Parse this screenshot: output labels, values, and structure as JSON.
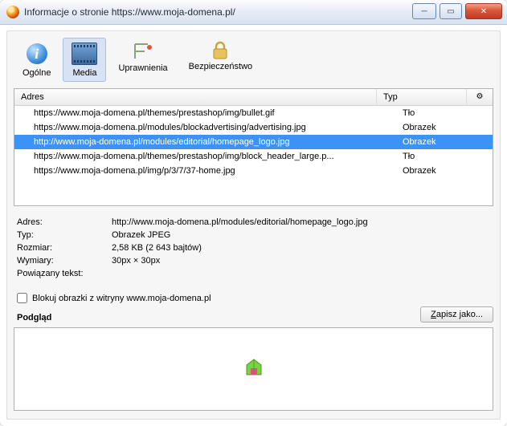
{
  "window": {
    "title": "Informacje o stronie https://www.moja-domena.pl/"
  },
  "toolbar": {
    "general": "Ogólne",
    "media": "Media",
    "permissions": "Uprawnienia",
    "security": "Bezpieczeństwo"
  },
  "table": {
    "headers": {
      "address": "Adres",
      "type": "Typ",
      "options": "⚙"
    },
    "rows": [
      {
        "addr": "https://www.moja-domena.pl/themes/prestashop/img/bullet.gif",
        "typ": "Tło",
        "selected": false
      },
      {
        "addr": "https://www.moja-domena.pl/modules/blockadvertising/advertising.jpg",
        "typ": "Obrazek",
        "selected": false
      },
      {
        "addr": "http://www.moja-domena.pl/modules/editorial/homepage_logo.jpg",
        "typ": "Obrazek",
        "selected": true
      },
      {
        "addr": "https://www.moja-domena.pl/themes/prestashop/img/block_header_large.p...",
        "typ": "Tło",
        "selected": false
      },
      {
        "addr": "https://www.moja-domena.pl/img/p/3/7/37-home.jpg",
        "typ": "Obrazek",
        "selected": false
      }
    ]
  },
  "details": {
    "labels": {
      "addr": "Adres:",
      "type": "Typ:",
      "size": "Rozmiar:",
      "dim": "Wymiary:",
      "assoc": "Powiązany tekst:"
    },
    "values": {
      "addr": "http://www.moja-domena.pl/modules/editorial/homepage_logo.jpg",
      "type": "Obrazek JPEG",
      "size": "2,58 KB (2 643 bajtów)",
      "dim": "30px × 30px",
      "assoc": ""
    }
  },
  "block_images_label": "Blokuj obrazki z witryny www.moja-domena.pl",
  "preview_label": "Podgląd",
  "save_as_label": "Zapisz jako..."
}
